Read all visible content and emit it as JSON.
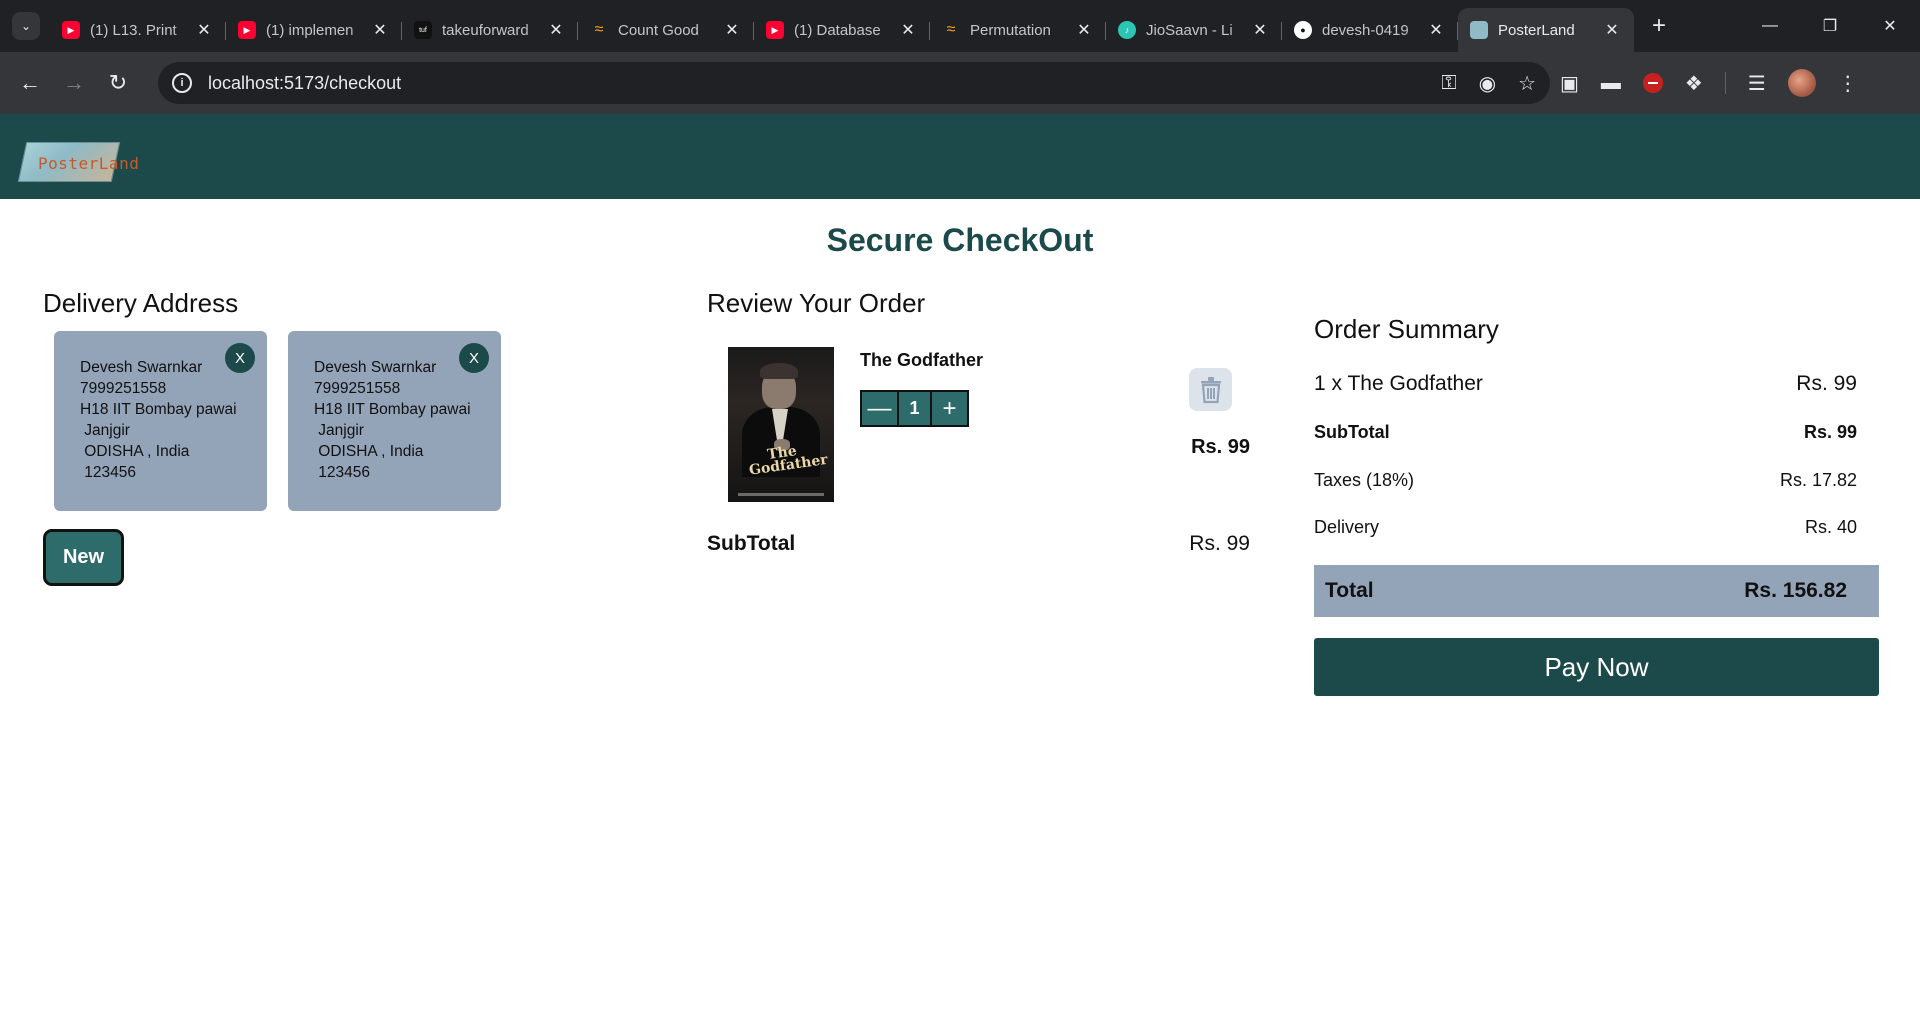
{
  "browser": {
    "tabs": [
      {
        "title": "(1) L13. Print",
        "favicon": "youtube-icon",
        "color": "#ff0033"
      },
      {
        "title": "(1) implemen",
        "favicon": "youtube-icon",
        "color": "#ff0033"
      },
      {
        "title": "takeuforward",
        "favicon": "tuf-icon",
        "color": "#111111"
      },
      {
        "title": "Count Good",
        "favicon": "leetcode-icon",
        "color": "#ffa116"
      },
      {
        "title": "(1) Database",
        "favicon": "youtube-icon",
        "color": "#ff0033"
      },
      {
        "title": "Permutation",
        "favicon": "leetcode-icon",
        "color": "#ffa116"
      },
      {
        "title": "JioSaavn - Li",
        "favicon": "jiosaavn-icon",
        "color": "#2bc5b4"
      },
      {
        "title": "devesh-0419",
        "favicon": "github-icon",
        "color": "#ffffff"
      },
      {
        "title": "PosterLand",
        "favicon": "posterland-icon",
        "color": "#8fbac6"
      }
    ],
    "url": "localhost:5173/checkout"
  },
  "page": {
    "title": "Secure CheckOut"
  },
  "address": {
    "heading": "Delivery Address",
    "cards": [
      {
        "lines": [
          "Devesh Swarnkar",
          "7999251558",
          "H18 IIT Bombay pawai",
          " Janjgir",
          " ODISHA , India",
          " 123456"
        ],
        "remove_label": "X"
      },
      {
        "lines": [
          "Devesh Swarnkar",
          "7999251558",
          "H18 IIT Bombay pawai",
          " Janjgir",
          " ODISHA , India",
          " 123456"
        ],
        "remove_label": "X"
      }
    ],
    "new_label": "New"
  },
  "review": {
    "heading": "Review Your Order",
    "item": {
      "name": "The Godfather",
      "poster_title_line1": "The",
      "poster_title_line2": "Godfather",
      "quantity": "1",
      "price": "Rs. 99"
    },
    "subtotal_label": "SubTotal",
    "subtotal_value": "Rs. 99"
  },
  "summary": {
    "heading": "Order Summary",
    "line_item_label": "1 x The Godfather",
    "line_item_value": "Rs. 99",
    "subtotal_label": "SubTotal",
    "subtotal_value": "Rs. 99",
    "taxes_label": "Taxes (18%)",
    "taxes_value": "Rs. 17.82",
    "delivery_label": "Delivery",
    "delivery_value": "Rs. 40",
    "total_label": "Total",
    "total_value": "Rs. 156.82",
    "pay_label": "Pay Now"
  },
  "brand": {
    "logo_text": "PosterLand",
    "header_color": "#1c4a4a",
    "accent_button": "#2e6b6b",
    "card_color": "#93a3b8"
  }
}
